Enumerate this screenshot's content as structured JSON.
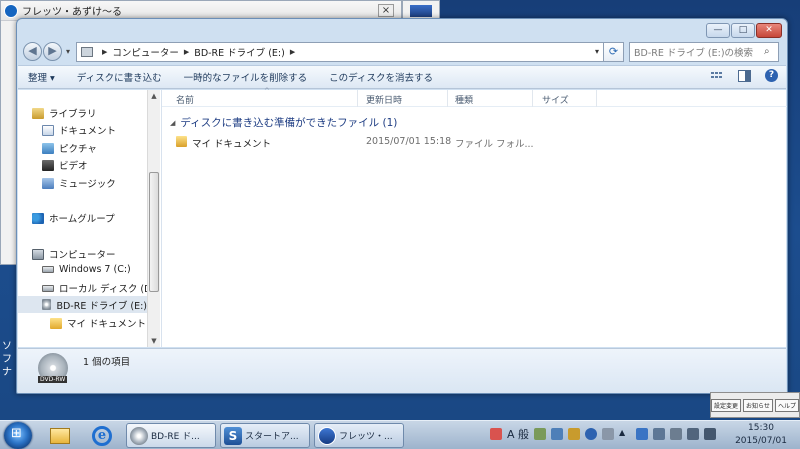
{
  "background_window": {
    "title": "フレッツ・あずけ〜る",
    "close": "×"
  },
  "desktop": {
    "side_text": "ソフ ナ"
  },
  "window": {
    "caption": {
      "minimize": "—",
      "maximize": "□",
      "close": "✕"
    },
    "address": {
      "back": "◀",
      "forward": "▶",
      "crumbs": [
        "コンピューター",
        "BD-RE ドライブ (E:)"
      ],
      "search_placeholder": "BD-RE ドライブ (E:)の検索"
    },
    "toolbar": {
      "items": [
        "整理 ▾",
        "ディスクに書き込む",
        "一時的なファイルを削除する",
        "このディスクを消去する"
      ]
    },
    "nav": {
      "items": [
        {
          "label": "ライブラリ",
          "icon": "library-icon"
        },
        {
          "label": "ドキュメント",
          "icon": "documents-icon"
        },
        {
          "label": "ピクチャ",
          "icon": "pictures-icon"
        },
        {
          "label": "ビデオ",
          "icon": "videos-icon"
        },
        {
          "label": "ミュージック",
          "icon": "music-icon"
        },
        {
          "label": "ホームグループ",
          "icon": "homegroup-icon"
        },
        {
          "label": "コンピューター",
          "icon": "computer-icon"
        },
        {
          "label": "Windows 7 (C:)",
          "icon": "drive-icon"
        },
        {
          "label": "ローカル ディスク (D:",
          "icon": "drive-icon"
        },
        {
          "label": "BD-RE ドライブ (E:)",
          "icon": "disc-drive-icon"
        },
        {
          "label": "マイ ドキュメント",
          "icon": "folder-icon"
        }
      ]
    },
    "columns": [
      "名前",
      "更新日時",
      "種類",
      "サイズ"
    ],
    "group_header": "ディスクに書き込む準備ができたファイル (1)",
    "files": [
      {
        "name": "マイ ドキュメント",
        "modified": "2015/07/01 15:18",
        "type": "ファイル フォル..."
      }
    ],
    "status": {
      "disc_label": "DVD-RW",
      "count_text": "1 個の項目"
    }
  },
  "ime_bar": [
    "設定変更",
    "お知らせ",
    "ヘルプ"
  ],
  "taskbar": {
    "tasks": [
      "BD-RE ド...",
      "スタートア...",
      "フレッツ・..."
    ],
    "ime_mode": "A 般",
    "clock": {
      "time": "15:30",
      "date": "2015/07/01"
    }
  }
}
